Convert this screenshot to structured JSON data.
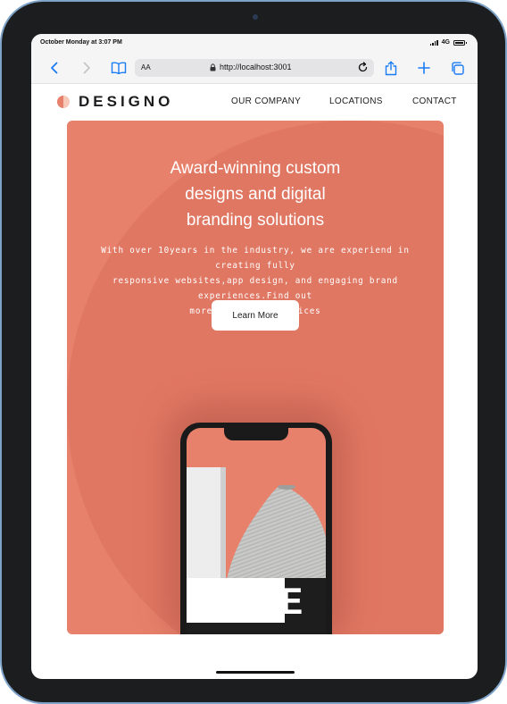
{
  "status": {
    "time": "October Monday at 3:07 PM",
    "network": "4G"
  },
  "browser": {
    "aa_label": "AA",
    "url": "http://localhost:3001"
  },
  "site": {
    "brand": "DESIGNO",
    "nav": [
      "OUR COMPANY",
      "LOCATIONS",
      "CONTACT"
    ]
  },
  "hero": {
    "title_lines": [
      "Award-winning custom",
      "designs and digital",
      "branding solutions"
    ],
    "text_lines": [
      "With over 10years in the industry, we are experiend in creating fully",
      "responsive websites,app design, and engaging brand experiences.Find out",
      "more about our services"
    ],
    "button_label": "Learn More",
    "phone_screen_text": "FRAME"
  },
  "colors": {
    "accent": "#e7816b",
    "ios_blue": "#1a7cf5",
    "dark": "#1d1c1e"
  },
  "icons": {
    "back": "chevron-left-icon",
    "forward": "chevron-right-icon",
    "bookmarks": "book-icon",
    "lock": "lock-icon",
    "reload": "reload-icon",
    "share": "share-icon",
    "new_tab": "plus-icon",
    "tabs": "tabs-icon"
  }
}
